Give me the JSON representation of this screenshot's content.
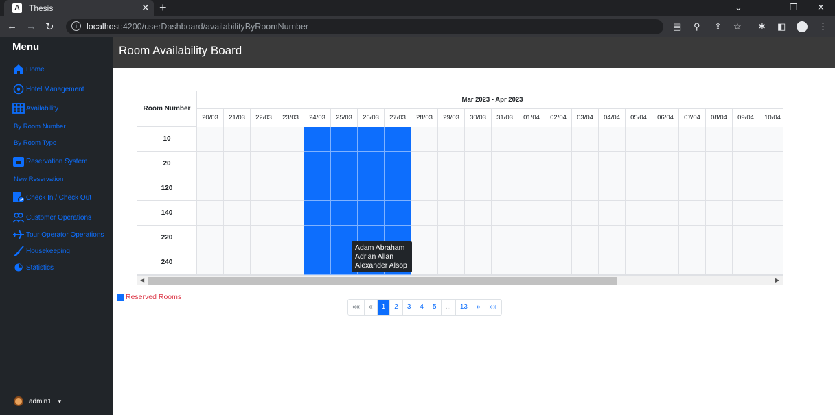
{
  "browser": {
    "tab_title": "Thesis",
    "tab_favicon_letter": "A",
    "url_host": "localhost",
    "url_rest": ":4200/userDashboard/availabilityByRoomNumber"
  },
  "sidebar": {
    "title": "Menu",
    "items": [
      {
        "label": "Home",
        "icon": "home-icon"
      },
      {
        "label": "Hotel Management",
        "icon": "hotel-management-icon"
      },
      {
        "label": "Availability",
        "icon": "table-icon"
      },
      {
        "label": "By Room Number"
      },
      {
        "label": "By Room Type"
      },
      {
        "label": "Reservation System",
        "icon": "calendar-icon"
      },
      {
        "label": "New Reservation"
      },
      {
        "label": "Check In / Check Out",
        "icon": "check-in-icon"
      },
      {
        "label": "Customer Operations",
        "icon": "users-icon"
      },
      {
        "label": "Tour Operator Operations",
        "icon": "plane-icon"
      },
      {
        "label": "Housekeeping",
        "icon": "broom-icon"
      },
      {
        "label": "Statistics",
        "icon": "pie-chart-icon"
      }
    ],
    "user": "admin1"
  },
  "header": {
    "title": "Room Availability Board"
  },
  "board": {
    "room_header": "Room Number",
    "period": "Mar 2023 - Apr 2023",
    "dates": [
      "20/03",
      "21/03",
      "22/03",
      "23/03",
      "24/03",
      "25/03",
      "26/03",
      "27/03",
      "28/03",
      "29/03",
      "30/03",
      "31/03",
      "01/04",
      "02/04",
      "03/04",
      "04/04",
      "05/04",
      "06/04",
      "07/04",
      "08/04",
      "09/04",
      "10/04"
    ],
    "rooms": [
      "10",
      "20",
      "120",
      "140",
      "220",
      "240"
    ],
    "reserved_dates": [
      "24/03",
      "25/03",
      "26/03",
      "27/03"
    ],
    "tooltip": [
      "Adam Abraham",
      "Adrian Allan",
      "Alexander Alsop"
    ]
  },
  "legend": {
    "label": "Reserved Rooms",
    "color": "#0d6efd"
  },
  "pagination": {
    "first": "««",
    "prev": "«",
    "pages": [
      "1",
      "2",
      "3",
      "4",
      "5",
      "...",
      "13"
    ],
    "active": "1",
    "next": "»",
    "last": "»»"
  }
}
